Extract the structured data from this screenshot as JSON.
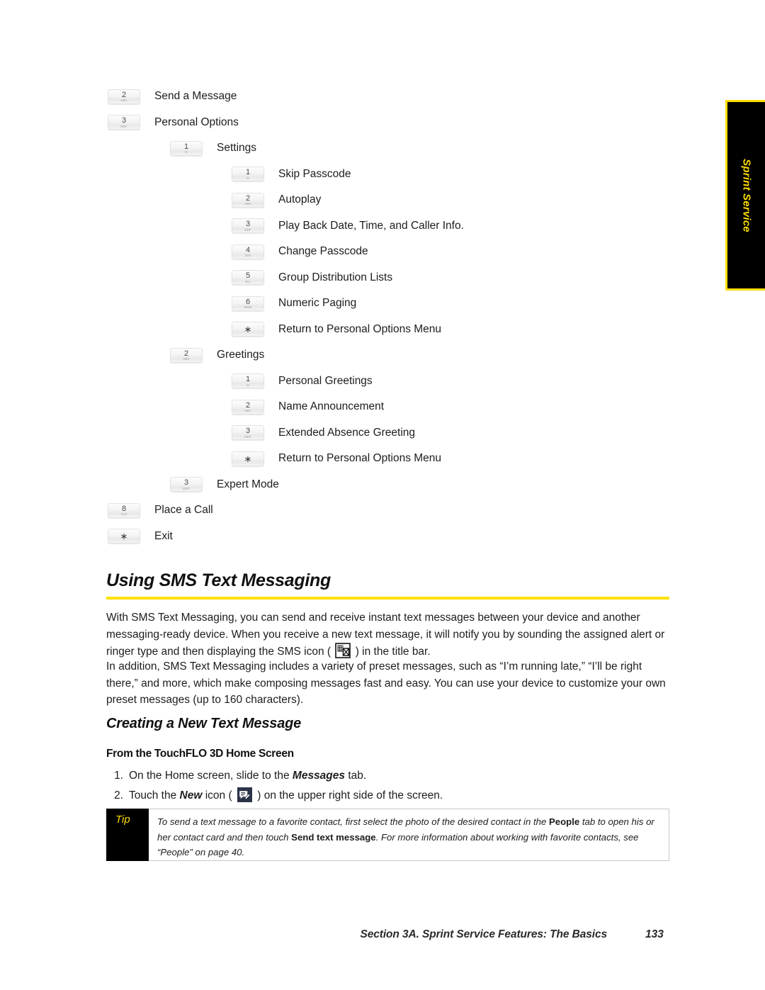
{
  "side_tab": {
    "label": "Sprint Service",
    "bg_color": "#000000",
    "text_color": "#FFDD00",
    "border_color": "#FFDD00"
  },
  "menu_tree": {
    "rows": [
      {
        "level": 1,
        "key": "2",
        "sub": "ABC",
        "label": "Send a Message"
      },
      {
        "level": 1,
        "key": "3",
        "sub": "DEF",
        "label": "Personal Options"
      },
      {
        "level": 2,
        "key": "1",
        "sub": "✉",
        "label": "Settings"
      },
      {
        "level": 3,
        "key": "1",
        "sub": "✉",
        "label": "Skip Passcode"
      },
      {
        "level": 3,
        "key": "2",
        "sub": "ABC",
        "label": "Autoplay"
      },
      {
        "level": 3,
        "key": "3",
        "sub": "DEF",
        "label": "Play Back Date, Time, and Caller Info."
      },
      {
        "level": 3,
        "key": "4",
        "sub": "GHI",
        "label": "Change Passcode"
      },
      {
        "level": 3,
        "key": "5",
        "sub": "JKL",
        "label": "Group Distribution Lists"
      },
      {
        "level": 3,
        "key": "6",
        "sub": "MNO",
        "label": "Numeric Paging"
      },
      {
        "level": 3,
        "key": "∗",
        "sub": "",
        "label": "Return to Personal Options Menu"
      },
      {
        "level": 2,
        "key": "2",
        "sub": "ABC",
        "label": "Greetings"
      },
      {
        "level": 3,
        "key": "1",
        "sub": "✉",
        "label": "Personal Greetings"
      },
      {
        "level": 3,
        "key": "2",
        "sub": "ABC",
        "label": "Name Announcement"
      },
      {
        "level": 3,
        "key": "3",
        "sub": "DEF",
        "label": "Extended Absence Greeting"
      },
      {
        "level": 3,
        "key": "∗",
        "sub": "",
        "label": "Return to Personal Options Menu"
      },
      {
        "level": 2,
        "key": "3",
        "sub": "DEF",
        "label": "Expert Mode"
      },
      {
        "level": 1,
        "key": "8",
        "sub": "TUV",
        "label": "Place a Call"
      },
      {
        "level": 1,
        "key": "∗",
        "sub": "",
        "label": "Exit"
      }
    ]
  },
  "headings": {
    "h1": "Using SMS Text Messaging",
    "h1_rule_color": "#FFE000",
    "h2": "Creating a New Text Message",
    "h3": "From the TouchFLO 3D Home Screen"
  },
  "paragraphs": {
    "p1_a": "With SMS Text Messaging, you can send and receive instant text messages between your device and another messaging-ready device. When you receive a new text message, it will notify you by sounding the assigned alert or ringer type and then displaying the SMS icon ( ",
    "p1_b": " ) in the title bar.",
    "p2": "In addition, SMS Text Messaging includes a variety of preset messages, such as “I’m running late,” “I’ll be right there,” and more, which make composing messages fast and easy. You can use your device to customize your own preset messages (up to 160 characters)."
  },
  "steps": [
    {
      "num": "1.",
      "text_a": "On the Home screen, slide to the ",
      "emphasis": "Messages",
      "text_b": " tab."
    },
    {
      "num": "2.",
      "text_a": "Touch the ",
      "emphasis": "New",
      "text_b": " icon ( ",
      "text_c": " ) on the upper right side of the screen."
    }
  ],
  "tip": {
    "label": "Tip",
    "text_a": "To send a text message to a favorite contact, first select the photo of the desired contact in the ",
    "bold_1": "People",
    "text_b": " tab to open his or her contact card and then touch ",
    "bold_2": "Send text message",
    "text_c": ". For more information about working with favorite contacts, see “People” on page 40.",
    "label_color": "#FFDD00",
    "tab_bg": "#000000"
  },
  "footer": {
    "title": "Section 3A. Sprint Service Features: The Basics",
    "page": "133"
  }
}
